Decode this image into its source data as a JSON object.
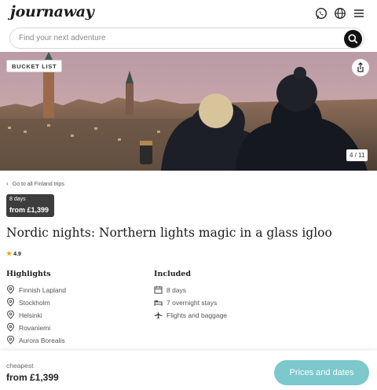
{
  "header": {
    "logo_text": "journaway",
    "icons": [
      "whatsapp-icon",
      "globe-icon",
      "menu-icon"
    ]
  },
  "search": {
    "placeholder": "Find your next adventure",
    "icon": "search-icon"
  },
  "hero": {
    "badge": "BUCKET LIST",
    "counter": "4 / 11",
    "share_icon": "share-icon"
  },
  "breadcrumb": {
    "back_label": "Go to all Finland trips"
  },
  "price_box": {
    "duration": "8 days",
    "price": "from £1,399"
  },
  "trip": {
    "title": "Nordic nights: Northern lights magic in a glass igloo",
    "rating": "4.9"
  },
  "highlights": {
    "heading": "Highlights",
    "items": [
      "Finnish Lapland",
      "Stockholm",
      "Helsinki",
      "Rovaniemi",
      "Aurora Borealis"
    ]
  },
  "included": {
    "heading": "Included",
    "items": [
      {
        "icon": "calendar-icon",
        "label": "8 days"
      },
      {
        "icon": "bed-icon",
        "label": "7 overnight stays"
      },
      {
        "icon": "plane-icon",
        "label": "Flights and baggage"
      }
    ]
  },
  "footer": {
    "label": "cheapest",
    "price": "from £1,399",
    "cta": "Prices and dates"
  },
  "colors": {
    "cta": "#7cc8cc",
    "price_box": "#3d3d3d",
    "star": "#e8a300"
  }
}
